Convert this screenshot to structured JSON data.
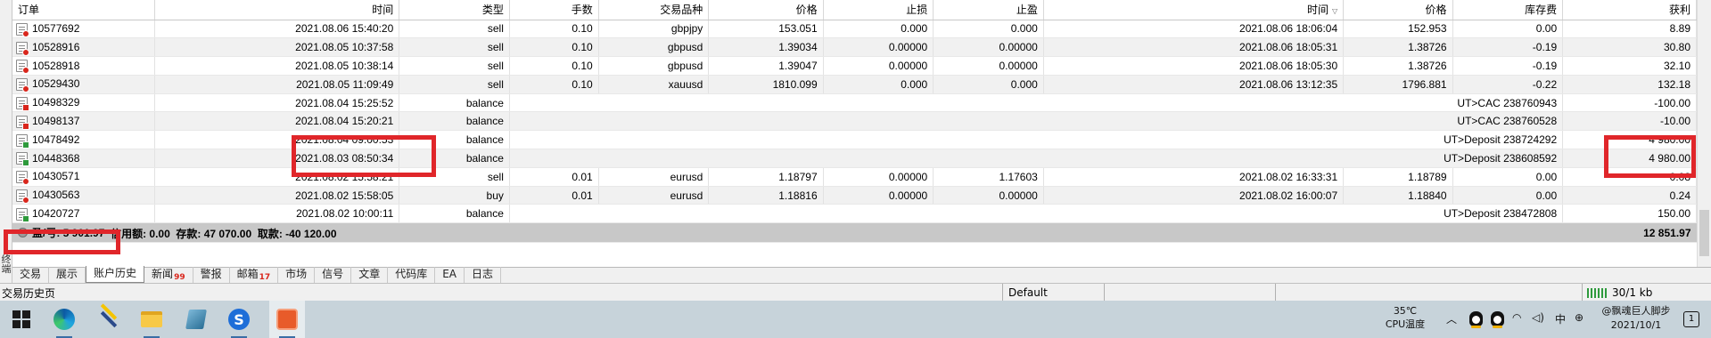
{
  "columns": [
    "订单",
    "时间",
    "类型",
    "手数",
    "交易品种",
    "价格",
    "止损",
    "止盈",
    "时间",
    "价格",
    "库存费",
    "获利"
  ],
  "rows": [
    {
      "icon": "sell",
      "order": "10577692",
      "open_time": "2021.08.06 15:40:20",
      "type": "sell",
      "lots": "0.10",
      "symbol": "gbpjpy",
      "open_price": "153.051",
      "sl": "0.000",
      "tp": "0.000",
      "close_time": "2021.08.06 18:06:04",
      "close_price": "152.953",
      "swap": "0.00",
      "profit": "8.89"
    },
    {
      "icon": "sell",
      "order": "10528916",
      "open_time": "2021.08.05 10:37:58",
      "type": "sell",
      "lots": "0.10",
      "symbol": "gbpusd",
      "open_price": "1.39034",
      "sl": "0.00000",
      "tp": "0.00000",
      "close_time": "2021.08.06 18:05:31",
      "close_price": "1.38726",
      "swap": "-0.19",
      "profit": "30.80"
    },
    {
      "icon": "sell",
      "order": "10528918",
      "open_time": "2021.08.05 10:38:14",
      "type": "sell",
      "lots": "0.10",
      "symbol": "gbpusd",
      "open_price": "1.39047",
      "sl": "0.00000",
      "tp": "0.00000",
      "close_time": "2021.08.06 18:05:30",
      "close_price": "1.38726",
      "swap": "-0.19",
      "profit": "32.10"
    },
    {
      "icon": "sell",
      "order": "10529430",
      "open_time": "2021.08.05 11:09:49",
      "type": "sell",
      "lots": "0.10",
      "symbol": "xauusd",
      "open_price": "1810.099",
      "sl": "0.000",
      "tp": "0.000",
      "close_time": "2021.08.06 13:12:35",
      "close_price": "1796.881",
      "swap": "-0.22",
      "profit": "132.18"
    },
    {
      "icon": "balance",
      "order": "10498329",
      "open_time": "2021.08.04 15:25:52",
      "type": "balance",
      "comment": "UT>CAC 238760943",
      "profit": "-100.00"
    },
    {
      "icon": "balance",
      "order": "10498137",
      "open_time": "2021.08.04 15:20:21",
      "type": "balance",
      "comment": "UT>CAC 238760528",
      "profit": "-10.00"
    },
    {
      "icon": "deposit",
      "order": "10478492",
      "open_time": "2021.08.04 09:00:53",
      "type": "balance",
      "comment": "UT>Deposit 238724292",
      "profit": "4 980.00"
    },
    {
      "icon": "deposit",
      "order": "10448368",
      "open_time": "2021.08.03 08:50:34",
      "type": "balance",
      "comment": "UT>Deposit 238608592",
      "profit": "4 980.00"
    },
    {
      "icon": "sell",
      "order": "10430571",
      "open_time": "2021.08.02 15:58:21",
      "type": "sell",
      "lots": "0.01",
      "symbol": "eurusd",
      "open_price": "1.18797",
      "sl": "0.00000",
      "tp": "1.17603",
      "close_time": "2021.08.02 16:33:31",
      "close_price": "1.18789",
      "swap": "0.00",
      "profit": "0.08"
    },
    {
      "icon": "buy",
      "order": "10430563",
      "open_time": "2021.08.02 15:58:05",
      "type": "buy",
      "lots": "0.01",
      "symbol": "eurusd",
      "open_price": "1.18816",
      "sl": "0.00000",
      "tp": "0.00000",
      "close_time": "2021.08.02 16:00:07",
      "close_price": "1.18840",
      "swap": "0.00",
      "profit": "0.24"
    },
    {
      "icon": "deposit",
      "order": "10420727",
      "open_time": "2021.08.02 10:00:11",
      "type": "balance",
      "comment": "UT>Deposit 238472808",
      "profit": "150.00"
    }
  ],
  "summary": {
    "pl": "盈/亏: 5 901.97",
    "credit": "信用额: 0.00",
    "deposit": "存款: 47 070.00",
    "withdrawal": "取款: -40 120.00",
    "total": "12 851.97"
  },
  "side_label": "终端",
  "tabs": [
    {
      "label": "交易"
    },
    {
      "label": "展示"
    },
    {
      "label": "账户历史",
      "active": true
    },
    {
      "label": "新闻",
      "badge": "99"
    },
    {
      "label": "警报"
    },
    {
      "label": "邮箱",
      "badge": "17"
    },
    {
      "label": "市场"
    },
    {
      "label": "信号"
    },
    {
      "label": "文章"
    },
    {
      "label": "代码库"
    },
    {
      "label": "EA"
    },
    {
      "label": "日志"
    }
  ],
  "status": {
    "left": "交易历史页",
    "profile": "Default",
    "traffic": "30/1 kb"
  },
  "taskbar": {
    "temperature": "35℃",
    "temp_label": "CPU温度",
    "ime": "中",
    "clock_line1": "@飘魂巨人脚步",
    "date": "2021/10/1",
    "notifications": "1"
  }
}
